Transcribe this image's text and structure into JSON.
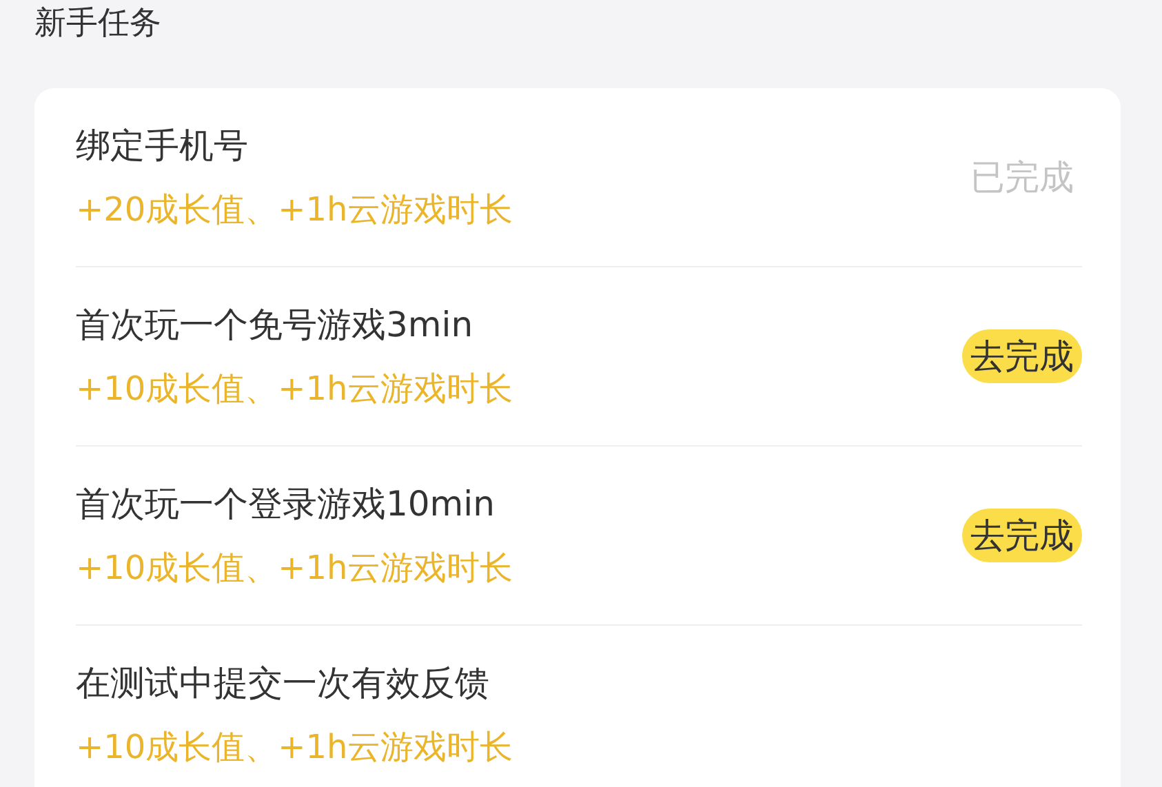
{
  "section": {
    "title": "新手任务"
  },
  "tasks": [
    {
      "title": "绑定手机号",
      "reward": "+20成长值、+1h云游戏时长",
      "action": {
        "label": "已完成",
        "completed": true
      }
    },
    {
      "title": "首次玩一个免号游戏3min",
      "reward": "+10成长值、+1h云游戏时长",
      "action": {
        "label": "去完成",
        "completed": false
      }
    },
    {
      "title": "首次玩一个登录游戏10min",
      "reward": "+10成长值、+1h云游戏时长",
      "action": {
        "label": "去完成",
        "completed": false
      }
    },
    {
      "title": "在测试中提交一次有效反馈",
      "reward": "+10成长值、+1h云游戏时长"
    }
  ]
}
